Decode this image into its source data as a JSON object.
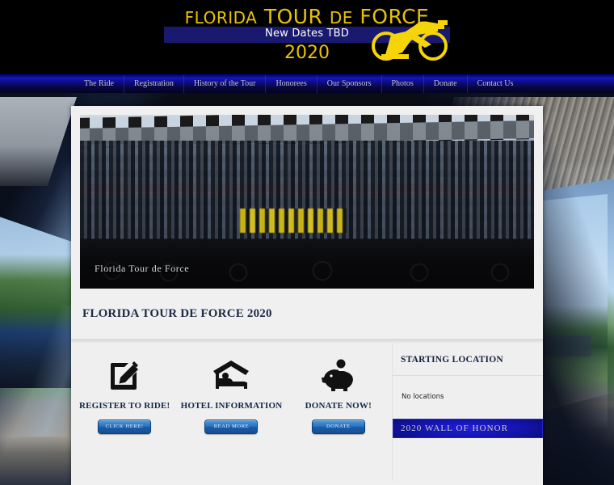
{
  "banner": {
    "title_part1": "FLORIDA",
    "title_part2": "TOUR",
    "title_part3": "DE",
    "title_part4": "FORCE",
    "title_full": "FLORIDA TOUR DE FORCE",
    "subtitle": "New Dates TBD",
    "year": "2020",
    "logo_icon": "cyclist-icon",
    "accent_color": "#e8c20a",
    "bar_color": "#191970"
  },
  "nav": {
    "items": [
      {
        "label": "The Ride"
      },
      {
        "label": "Registration"
      },
      {
        "label": "History of the Tour"
      },
      {
        "label": "Honorees"
      },
      {
        "label": "Our Sponsors"
      },
      {
        "label": "Photos"
      },
      {
        "label": "Donate"
      },
      {
        "label": "Contact Us"
      }
    ]
  },
  "hero": {
    "caption": "Florida Tour de Force",
    "alt": "Group photo of cyclists at a racetrack with checkered grandstand"
  },
  "main": {
    "page_title": "FLORIDA TOUR DE FORCE 2020",
    "features": [
      {
        "icon": "pencil-note-icon",
        "label": "REGISTER TO RIDE!",
        "button_label": "CLICK HERE!"
      },
      {
        "icon": "hotel-bed-icon",
        "label": "HOTEL INFORMATION",
        "button_label": "READ MORE"
      },
      {
        "icon": "piggy-bank-icon",
        "label": "DONATE NOW!",
        "button_label": "DONATE"
      }
    ]
  },
  "sidebar": {
    "starting_location_title": "STARTING LOCATION",
    "no_locations_text": "No locations",
    "wall_of_honor_label": "2020 WALL OF HONOR"
  },
  "colors": {
    "nav_blue": "#1414c8",
    "button_blue": "#2a72c0",
    "title_navy": "#1d2a44",
    "content_bg": "#f0f0f0"
  }
}
